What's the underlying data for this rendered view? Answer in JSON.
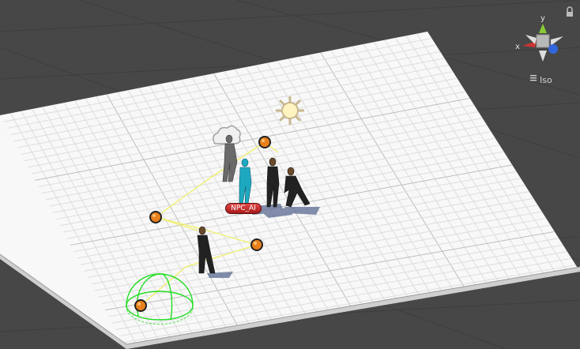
{
  "gizmo": {
    "axis_y": "y",
    "axis_x": "x",
    "projection_label": "Iso"
  },
  "npc_label": "NPC_AI",
  "colors": {
    "background": "#474747",
    "grid_plane": "#f8f8f8",
    "grid_lines": "#dddddd",
    "path_lines": "#f0f070",
    "waypoint": "#e8801c",
    "sphere_gizmo": "#22dd22",
    "selected_npc": "#1ea8c0",
    "npc_badge": "#c82a2a",
    "axis_x": "#cc3333",
    "axis_y": "#88cc33",
    "axis_z": "#3366dd"
  },
  "icons": [
    "lock-icon",
    "sun-light-icon",
    "cloud-icon",
    "scene-gizmo-icon"
  ]
}
